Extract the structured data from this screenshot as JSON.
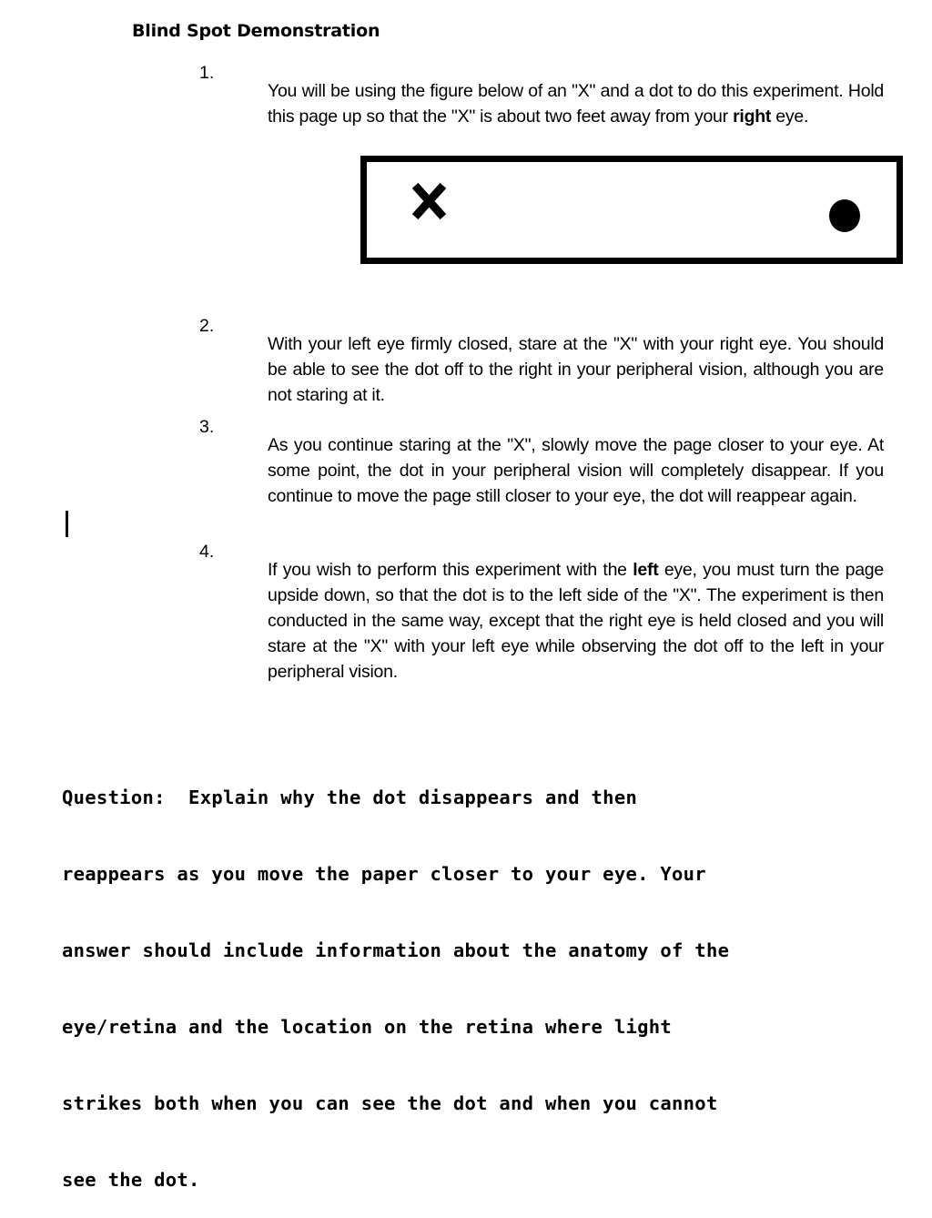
{
  "document": {
    "title": "Blind Spot Demonstration",
    "instructions": [
      {
        "number": "1.",
        "text_before_bold": "You will be using the figure below of an \"X\" and a dot to do this experiment.  Hold this page up so that the \"X\" is about two feet away from your ",
        "bold": "right",
        "text_after_bold": " eye."
      },
      {
        "number": "2.",
        "text_before_bold": "With your left eye firmly closed, stare at the \"X\" with your right eye. You should be able to see the dot off to the right in your peripheral vision, although you are not staring at it.",
        "bold": "",
        "text_after_bold": ""
      },
      {
        "number": "3.",
        "text_before_bold": "As you continue staring at the \"X\", slowly move the page closer to your eye.  At some point, the dot in your peripheral vision will completely disappear.  If you continue to move the page still closer to your eye, the dot will reappear again.",
        "bold": "",
        "text_after_bold": ""
      },
      {
        "number": "4.",
        "text_before_bold": "If you wish to perform this experiment with the ",
        "bold": "left",
        "text_after_bold": " eye, you must turn the page upside down, so that the dot is to the left side of the \"X\".  The experiment is then conducted in the same way, except that the right eye is held closed and you will stare at the \"X\" with your left eye while observing the dot off to the left in your peripheral vision."
      }
    ],
    "figure": {
      "x_mark_label": "X",
      "dot_label": "dot"
    },
    "question": {
      "lines": [
        "Question:  Explain why the dot disappears and then",
        "reappears as you move the paper closer to your eye. Your",
        "answer should include information about the anatomy of the",
        "eye/retina and the location on the retina where light",
        "strikes both when you can see the dot and when you cannot",
        "see the dot."
      ]
    },
    "colors": {
      "ink": "#000000",
      "paper": "#ffffff"
    }
  }
}
